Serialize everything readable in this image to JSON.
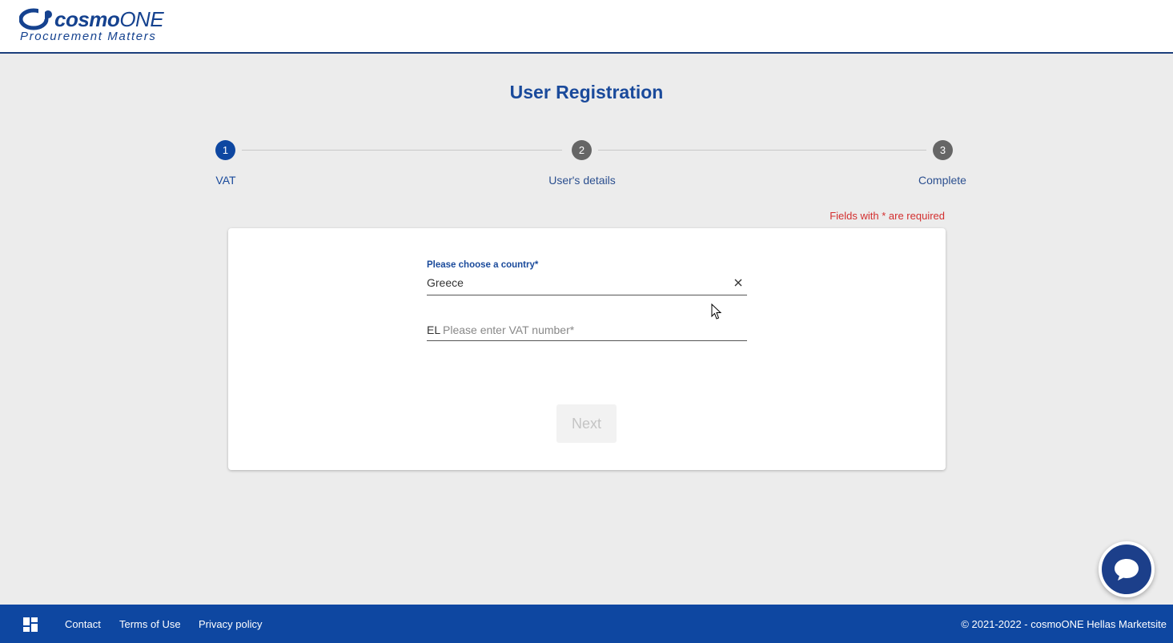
{
  "header": {
    "logo": {
      "brand_bold": "cosmo",
      "brand_light": "ONE",
      "tagline": "Procurement Matters"
    }
  },
  "page": {
    "title": "User Registration"
  },
  "stepper": {
    "steps": [
      {
        "number": "1",
        "label": "VAT",
        "state": "active"
      },
      {
        "number": "2",
        "label": "User's details",
        "state": "inactive"
      },
      {
        "number": "3",
        "label": "Complete",
        "state": "inactive"
      }
    ]
  },
  "form": {
    "required_note": "Fields with * are required",
    "country": {
      "label": "Please choose a country*",
      "value": "Greece",
      "clear_icon": "close-icon"
    },
    "vat": {
      "prefix": "EL",
      "placeholder": "Please enter VAT number*",
      "value": ""
    },
    "next_label": "Next"
  },
  "chat": {
    "icon": "chat-bubble-icon"
  },
  "footer": {
    "icon": "dashboard-icon",
    "links": [
      "Contact",
      "Terms of Use",
      "Privacy policy"
    ],
    "copyright": "© 2021-2022 - cosmoONE Hellas Marketsite"
  },
  "colors": {
    "brand": "#0e47a1",
    "title": "#1a4a9b",
    "required": "#d32f2f",
    "background": "#ececec"
  }
}
